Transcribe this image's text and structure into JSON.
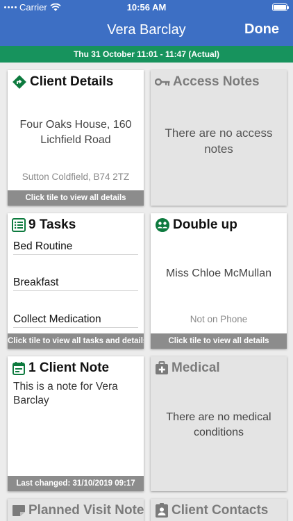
{
  "status_bar": {
    "carrier": "Carrier",
    "time": "10:56 AM"
  },
  "nav": {
    "title": "Vera Barclay",
    "done_label": "Done"
  },
  "visit": {
    "text": "Thu 31 October 11:01 - 11:47 (Actual)"
  },
  "colors": {
    "nav_blue": "#3d6fc4",
    "visit_green": "#17935d",
    "icon_green": "#0d7a3e",
    "footer_grey": "#8c8c8c",
    "tile_grey": "#e4e4e4"
  },
  "tiles": {
    "client_details": {
      "title": "Client Details",
      "address": "Four Oaks House, 160 Lichfield Road",
      "postcode": "Sutton Coldfield, B74 2TZ",
      "footer": "Click tile to view all details",
      "icon": "directions-icon"
    },
    "access_notes": {
      "title": "Access Notes",
      "message": "There are no access notes",
      "icon": "key-icon"
    },
    "tasks": {
      "title": "9 Tasks",
      "items": [
        "Bed Routine",
        "Breakfast",
        "Collect Medication"
      ],
      "footer": "Click tile to view all tasks and details",
      "icon": "list-icon"
    },
    "double_up": {
      "title": "Double up",
      "name": "Miss Chloe McMullan",
      "phone_status": "Not on Phone",
      "footer": "Click tile to view all details",
      "icon": "team-icon"
    },
    "client_note": {
      "title": "1 Client Note",
      "text": "This is a note for Vera Barclay",
      "footer": "Last changed: 31/10/2019 09:17",
      "icon": "calendar-icon"
    },
    "medical": {
      "title": "Medical",
      "message": "There are no medical conditions",
      "icon": "medical-kit-icon"
    },
    "planned_visit_note": {
      "title": "Planned Visit Note",
      "icon": "note-icon"
    },
    "client_contacts": {
      "title": "Client Contacts",
      "icon": "contact-card-icon"
    }
  }
}
